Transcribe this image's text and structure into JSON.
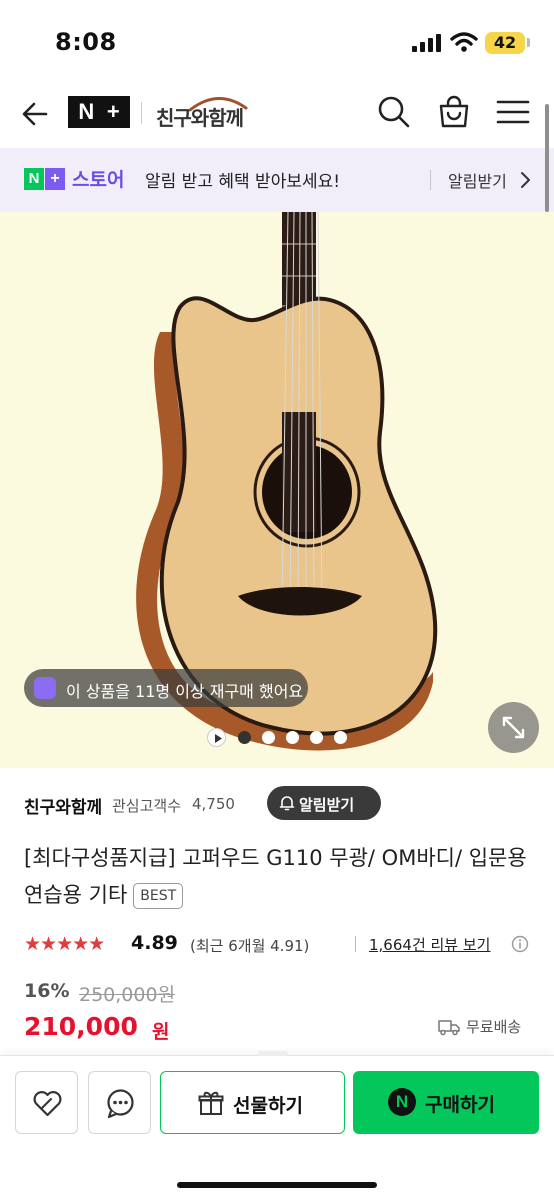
{
  "status_bar": {
    "time": "8:08",
    "battery": "42"
  },
  "header": {
    "back_icon": "arrow-left-icon",
    "nplus_logo": {
      "n": "N",
      "plus": "+"
    },
    "brand_logo_text": "친구와함께",
    "icons": [
      "search-icon",
      "shopping-bag-icon",
      "hamburger-menu-icon"
    ]
  },
  "banner": {
    "logo": {
      "n": "N",
      "plus": "+"
    },
    "store": "스토어",
    "message": "알림 받고 혜택 받아보세요!",
    "cta": "알림받기"
  },
  "product_image": {
    "background_color": "#fbf9de",
    "repurchase_text": "이 상품을 11명 이상 재구매 했어요",
    "slide_count": 5,
    "active_slide": 1,
    "has_video": true,
    "expand_icon": "expand-arrows-icon"
  },
  "seller": {
    "name": "친구와함께",
    "followers_label": "관심고객수",
    "followers_count": "4,750",
    "notify_button": "알림받기"
  },
  "product": {
    "title": "[최다구성품지급] 고퍼우드 G110 무광/ OM바디/ 입문용 연습용 기타",
    "badge": "BEST",
    "stars": "★★★★★",
    "rating": "4.89",
    "recent_rating": "(최근 6개월 4.91)",
    "review_link": "1,664건 리뷰 보기"
  },
  "price": {
    "discount": "16%",
    "original": "250,000원",
    "sale": "210,000",
    "unit": "원",
    "delivery": "무료배송"
  },
  "bottom_bar": {
    "gift_button": "선물하기",
    "buy_button": "구매하기",
    "buy_logo": "N"
  },
  "colors": {
    "naver_green": "#03c75a",
    "nplus_purple": "#6b4de6",
    "price_red": "#e8112d",
    "star_red": "#e33b3b",
    "banner_bg": "#f1eef9"
  }
}
